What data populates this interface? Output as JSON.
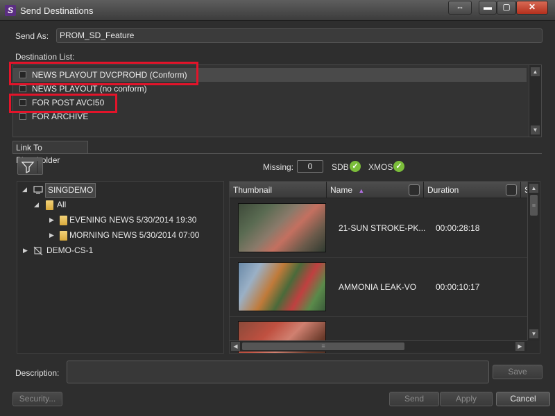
{
  "window": {
    "title": "Send Destinations",
    "close_glyph": "✕",
    "minimize_glyph": "▬",
    "maximize_glyph": "▢",
    "restore_glyph": "⇔"
  },
  "send_as": {
    "label": "Send As:",
    "value": "PROM_SD_Feature"
  },
  "destination_list": {
    "label": "Destination List:",
    "items": [
      {
        "label": "NEWS PLAYOUT DVCPROHD (Conform)",
        "checked": false,
        "selected": true,
        "highlighted": true
      },
      {
        "label": "NEWS PLAYOUT (no conform)",
        "checked": false,
        "selected": false,
        "highlighted": false
      },
      {
        "label": "FOR POST AVCI50",
        "checked": false,
        "selected": false,
        "highlighted": true
      },
      {
        "label": "FOR ARCHIVE",
        "checked": false,
        "selected": false,
        "highlighted": false
      }
    ]
  },
  "tab": {
    "label": "Link To Placeholder"
  },
  "status": {
    "missing_label": "Missing:",
    "missing_value": "0",
    "sdb_label": "SDB",
    "xmos_label": "XMOS",
    "check_glyph": "✓"
  },
  "tree": {
    "nodes": [
      {
        "label": "SINGDEMO",
        "expander": "◢",
        "icon": "monitor-icon"
      },
      {
        "label": "All",
        "expander": "◢",
        "icon": "folder-icon"
      },
      {
        "label": "EVENING NEWS 5/30/2014 19:30",
        "expander": "▶",
        "icon": "folder-icon"
      },
      {
        "label": "MORNING NEWS 5/30/2014 07:00",
        "expander": "▶",
        "icon": "folder-icon"
      },
      {
        "label": "DEMO-CS-1",
        "expander": "▶",
        "icon": "disconnected-server-icon"
      }
    ]
  },
  "grid": {
    "columns": [
      "Thumbnail",
      "Name",
      "Duration",
      "S"
    ],
    "sort_glyph": "▲",
    "rows": [
      {
        "name": "21-SUN STROKE-PK...",
        "duration": "00:00:28:18"
      },
      {
        "name": "AMMONIA LEAK-VO",
        "duration": "00:00:10:17"
      },
      {
        "name": "",
        "duration": ""
      }
    ]
  },
  "description": {
    "label": "Description:",
    "value": ""
  },
  "buttons": {
    "save": "Save",
    "security": "Security...",
    "send": "Send",
    "apply": "Apply",
    "cancel": "Cancel"
  },
  "scroll": {
    "up": "▲",
    "down": "▼",
    "left": "◀",
    "right": "▶",
    "grip": "≡"
  },
  "colors": {
    "highlight": "#e3142a",
    "accent_check": "#7bbd3a",
    "app_icon": "#5b2e82"
  }
}
